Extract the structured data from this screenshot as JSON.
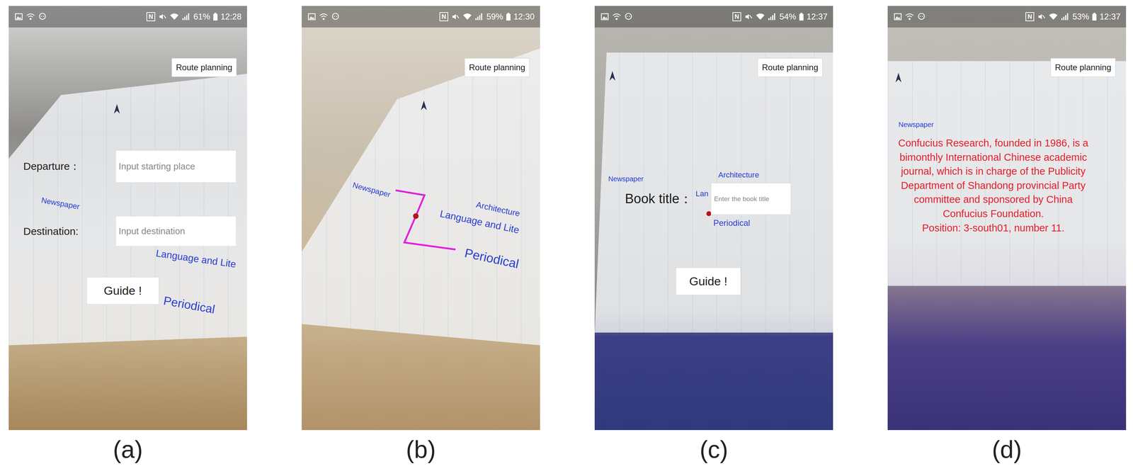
{
  "figure_panels": [
    {
      "caption": "(a)",
      "kind": "route-form",
      "status_bar": {
        "nfc": "N",
        "battery": "61%",
        "time": "12:28"
      },
      "route_button": "Route planning",
      "labels": [
        "Newspaper",
        "Language and Lite",
        "Periodical"
      ],
      "form": {
        "fields": [
          {
            "label": "Departure：",
            "placeholder": "Input starting place"
          },
          {
            "label": "Destination:",
            "placeholder": "Input destination"
          }
        ],
        "button": "Guide !"
      }
    },
    {
      "caption": "(b)",
      "kind": "route-path",
      "status_bar": {
        "nfc": "N",
        "battery": "59%",
        "time": "12:30"
      },
      "route_button": "Route planning",
      "labels": [
        "Newspaper",
        "Architecture",
        "Language and Lite",
        "Periodical"
      ]
    },
    {
      "caption": "(c)",
      "kind": "book-form",
      "status_bar": {
        "nfc": "N",
        "battery": "54%",
        "time": "12:37"
      },
      "route_button": "Route planning",
      "labels": [
        "Newspaper",
        "Architecture",
        "Lan",
        "Periodical"
      ],
      "form": {
        "fields": [
          {
            "label": "Book title：",
            "placeholder": "Enter the book title"
          }
        ],
        "button": "Guide !"
      }
    },
    {
      "caption": "(d)",
      "kind": "book-info",
      "status_bar": {
        "nfc": "N",
        "battery": "53%",
        "time": "12:37"
      },
      "route_button": "Route planning",
      "labels": [
        "Newspaper"
      ],
      "info": [
        "Confucius Research, founded in 1986, is a bimonthly International Chinese academic journal, which is in charge of the Publicity Department of Shandong provincial Party committee and sponsored by China Confucius Foundation.",
        "Position: 3-south01, number 11."
      ]
    }
  ]
}
